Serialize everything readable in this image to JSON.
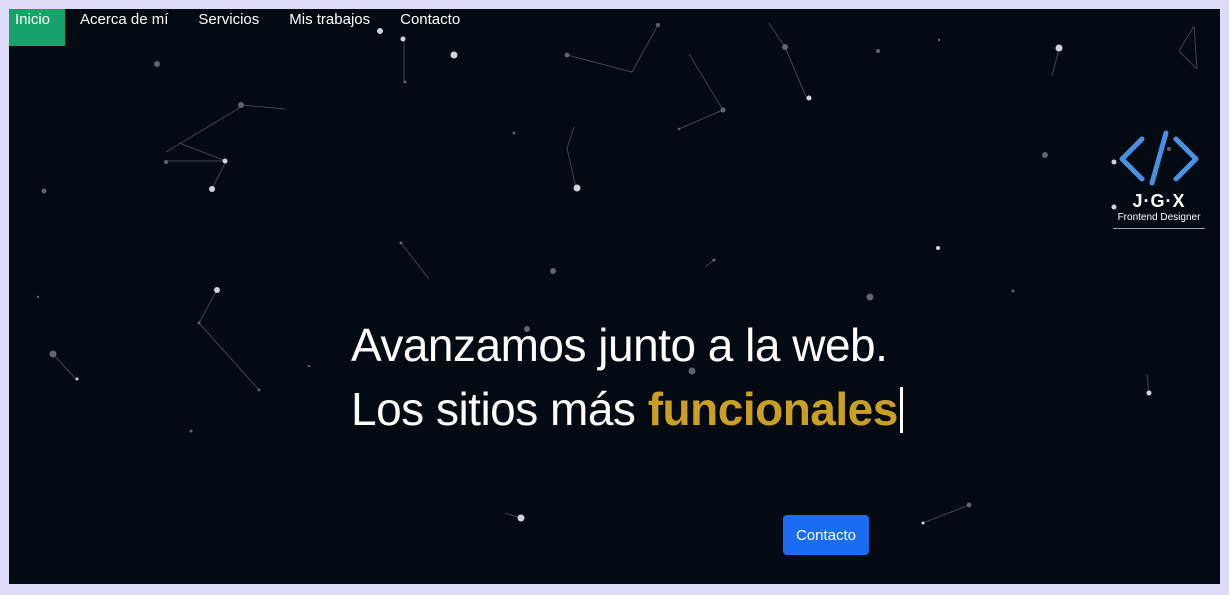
{
  "nav": {
    "items": [
      {
        "label": "Inicio",
        "active": true
      },
      {
        "label": "Acerca de mí",
        "active": false
      },
      {
        "label": "Servicios",
        "active": false
      },
      {
        "label": "Mis trabajos",
        "active": false
      },
      {
        "label": "Contacto",
        "active": false
      }
    ]
  },
  "logo": {
    "icon": "code-brackets-icon",
    "name": "J·G·X",
    "subtitle": "Frontend Designer"
  },
  "hero": {
    "line1": "Avanzamos junto a la web.",
    "line2_prefix": "Los sitios más ",
    "line2_highlight": "funcionales"
  },
  "cta": {
    "label": "Contacto"
  },
  "colors": {
    "background": "#030a12",
    "nav_active": "#16a36a",
    "accent": "#caa024",
    "button": "#1a6cf2",
    "logo_icon": "#4a90e2"
  }
}
